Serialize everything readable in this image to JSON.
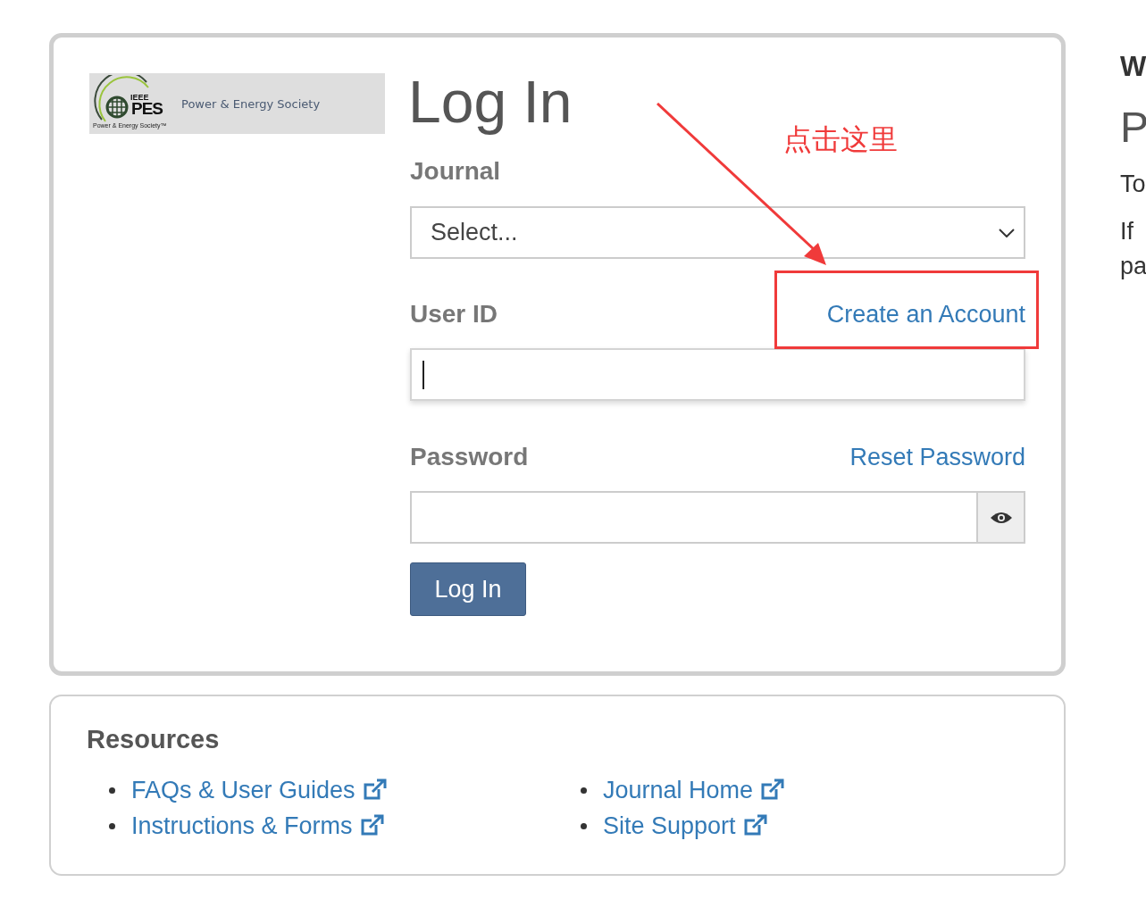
{
  "logo": {
    "org": "IEEE",
    "acronym": "PES",
    "small_caption": "Power & Energy Society™",
    "name": "Power & Energy Society"
  },
  "login": {
    "title": "Log In",
    "journal": {
      "label": "Journal",
      "placeholder": "Select..."
    },
    "user_id": {
      "label": "User ID",
      "link": "Create an Account",
      "focused": true
    },
    "password": {
      "label": "Password",
      "link": "Reset Password"
    },
    "button": "Log In"
  },
  "annotation": {
    "text": "点击这里"
  },
  "resources": {
    "title": "Resources",
    "columns": [
      [
        {
          "label": "FAQs & User Guides"
        },
        {
          "label": "Instructions & Forms"
        }
      ],
      [
        {
          "label": "Journal Home"
        },
        {
          "label": "Site Support"
        }
      ]
    ]
  },
  "side_panel": {
    "heading": "W",
    "title": "P",
    "lines": [
      "To",
      "If",
      "pa"
    ]
  }
}
